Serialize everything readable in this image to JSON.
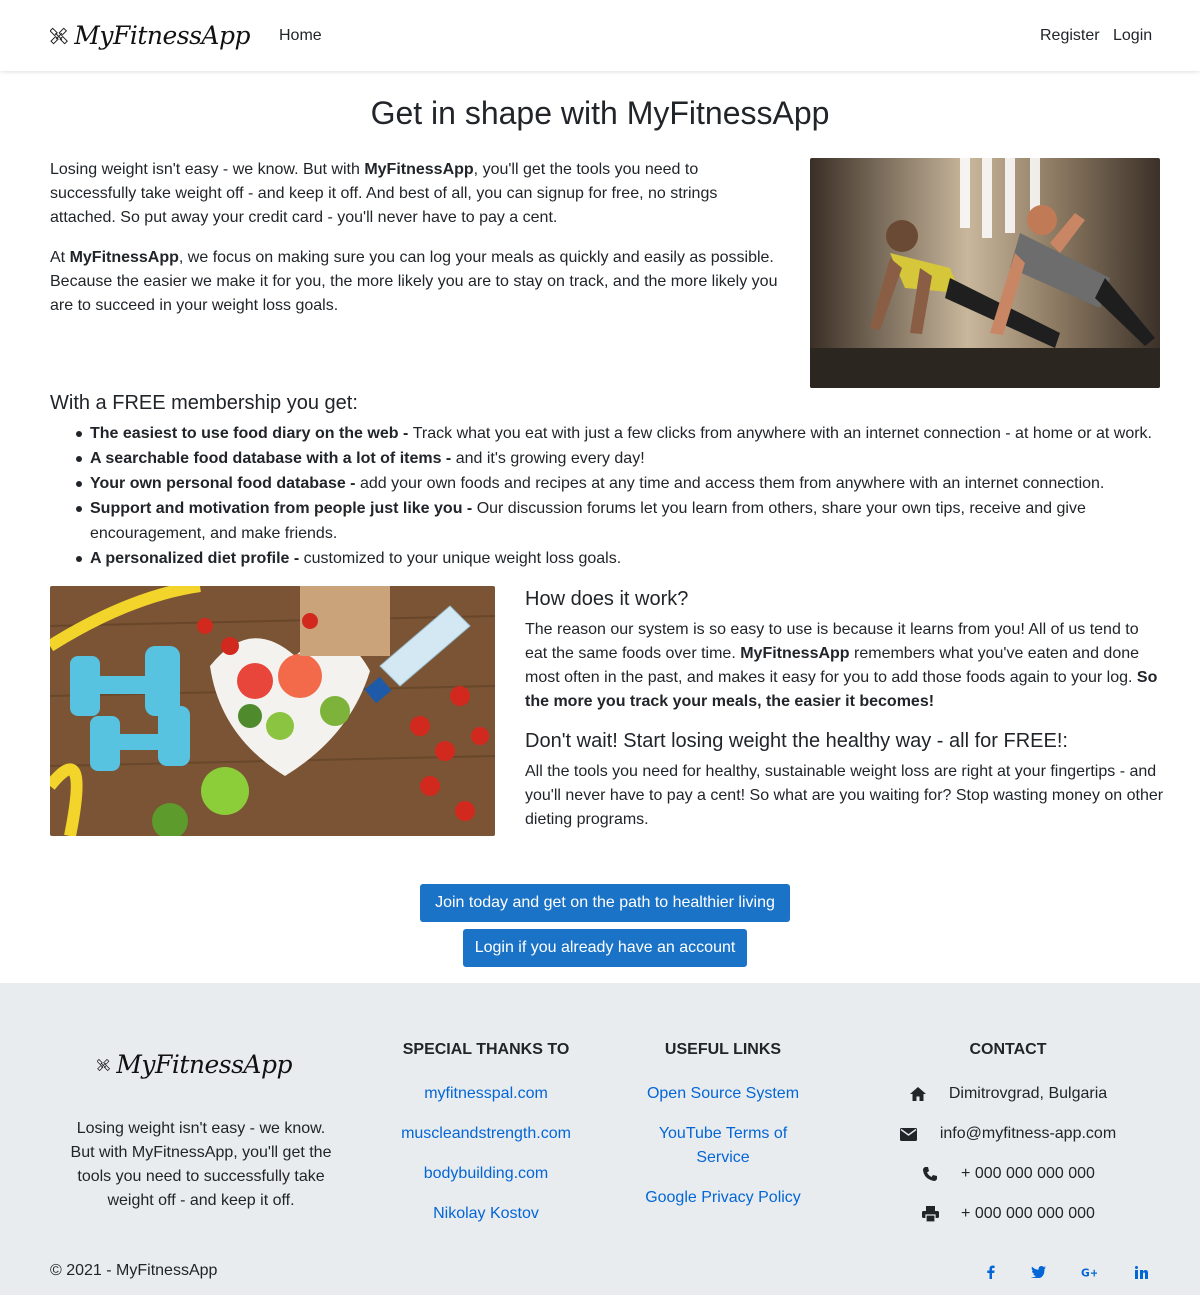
{
  "nav": {
    "brand": "MyFitnessApp",
    "home": "Home",
    "register": "Register",
    "login": "Login"
  },
  "main": {
    "title": "Get in shape with MyFitnessApp",
    "intro_p1_a": "Losing weight isn't easy - we know. But with ",
    "intro_p1_brand": "MyFitnessApp",
    "intro_p1_b": ", you'll get the tools you need to successfully take weight off - and keep it off. And best of all, you can signup for free, no strings attached. So put away your credit card - you'll never have to pay a cent.",
    "intro_p2_a": "At ",
    "intro_p2_brand": "MyFitnessApp",
    "intro_p2_b": ", we focus on making sure you can log your meals as quickly and easily as possible. Because the easier we make it for you, the more likely you are to stay on track, and the more likely you are to succeed in your weight loss goals.",
    "benefits_heading": "With a FREE membership you get:",
    "benefits": [
      {
        "bold": "The easiest to use food diary on the web - ",
        "text": "Track what you eat with just a few clicks from anywhere with an internet connection - at home or at work."
      },
      {
        "bold": "A searchable food database with a lot of items - ",
        "text": "and it's growing every day!"
      },
      {
        "bold": "Your own personal food database - ",
        "text": "add your own foods and recipes at any time and access them from anywhere with an internet connection."
      },
      {
        "bold": "Support and motivation from people just like you - ",
        "text": "Our discussion forums let you learn from others, share your own tips, receive and give encouragement, and make friends."
      },
      {
        "bold": "A personalized diet profile - ",
        "text": "customized to your unique weight loss goals."
      }
    ],
    "how_heading": "How does it work?",
    "how_p_a": "The reason our system is so easy to use is because it learns from you! All of us tend to eat the same foods over time. ",
    "how_p_brand": "MyFitnessApp",
    "how_p_b": " remembers what you've eaten and done most often in the past, and makes it easy for you to add those foods again to your log. ",
    "how_p_bold": "So the more you track your meals, the easier it becomes!",
    "wait_heading": "Don't wait! Start losing weight the healthy way - all for FREE!:",
    "wait_p": "All the tools you need for healthy, sustainable weight loss are right at your fingertips - and you'll never have to pay a cent! So what are you waiting for? Stop wasting money on other dieting programs.",
    "btn_join": "Join today and get on the path to healthier living",
    "btn_login": "Login if you already have an account"
  },
  "footer": {
    "brand": "MyFitnessApp",
    "desc": "Losing weight isn't easy - we know. But with MyFitnessApp, you'll get the tools you need to successfully take weight off - and keep it off.",
    "thanks_heading": "SPECIAL THANKS TO",
    "thanks": [
      "myfitnesspal.com",
      "muscleandstrength.com",
      "bodybuilding.com",
      "Nikolay Kostov"
    ],
    "links_heading": "USEFUL LINKS",
    "links": [
      "Open Source System",
      "YouTube Terms of Service",
      "Google Privacy Policy"
    ],
    "contact_heading": "CONTACT",
    "contact": {
      "address": "Dimitrovgrad, Bulgaria",
      "email": "info@myfitness-app.com",
      "phone": "+ 000 000 000 000",
      "fax": "+ 000 000 000 000"
    },
    "copyright": "© 2021 - MyFitnessApp",
    "social": [
      "facebook-icon",
      "twitter-icon",
      "google-plus-icon",
      "linkedin-icon"
    ]
  },
  "colors": {
    "accent": "#1a73c6",
    "link": "#0366d6",
    "footer_bg": "#e9ecef"
  }
}
